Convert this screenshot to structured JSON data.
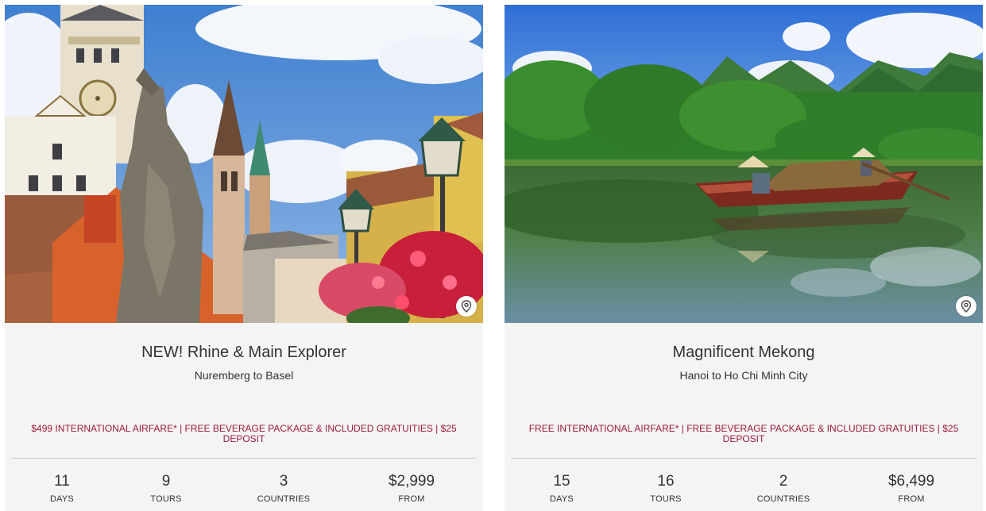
{
  "cards": [
    {
      "title": "NEW! Rhine & Main Explorer",
      "route": "Nuremberg to Basel",
      "promo": "$499 INTERNATIONAL AIRFARE* | FREE BEVERAGE PACKAGE & INCLUDED GRATUITIES | $25 DEPOSIT",
      "stats": [
        {
          "value": "11",
          "label": "DAYS"
        },
        {
          "value": "9",
          "label": "TOURS"
        },
        {
          "value": "3",
          "label": "COUNTRIES"
        },
        {
          "value": "$2,999",
          "label": "FROM"
        }
      ],
      "image_icon": "map-pin-icon"
    },
    {
      "title": "Magnificent Mekong",
      "route": "Hanoi to Ho Chi Minh City",
      "promo": "FREE INTERNATIONAL AIRFARE* | FREE BEVERAGE PACKAGE & INCLUDED GRATUITIES | $25 DEPOSIT",
      "stats": [
        {
          "value": "15",
          "label": "DAYS"
        },
        {
          "value": "16",
          "label": "TOURS"
        },
        {
          "value": "2",
          "label": "COUNTRIES"
        },
        {
          "value": "$6,499",
          "label": "FROM"
        }
      ],
      "image_icon": "map-pin-icon"
    }
  ],
  "colors": {
    "card_background": "#f4f4f4",
    "promo_text": "#9b1b3a",
    "divider": "#c9c9c9"
  }
}
